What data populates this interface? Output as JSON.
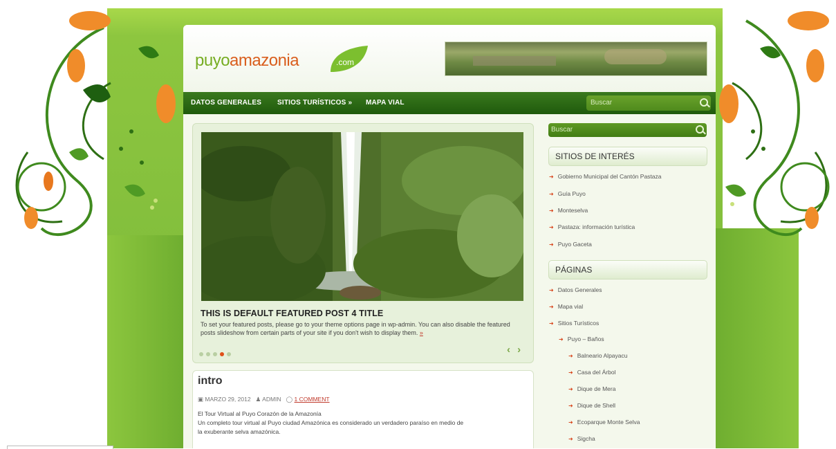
{
  "colors": {
    "green": "#8dc63f",
    "dark_green": "#2b6a14",
    "orange": "#e0501a"
  },
  "logo": {
    "part1": "puyo",
    "part2": "amazonia",
    "tld": ".com"
  },
  "nav": {
    "items": [
      {
        "label": "DATOS GENERALES"
      },
      {
        "label": "SITIOS TURÍSTICOS »"
      },
      {
        "label": "MAPA VIAL"
      }
    ],
    "search_placeholder": "Buscar"
  },
  "featured": {
    "title": "THIS IS DEFAULT FEATURED POST 4 TITLE",
    "text": "To set your featured posts, please go to your theme options page in wp-admin. You can also disable the featured posts slideshow from certain parts of your site if you don't wish to display them.",
    "more": "»",
    "active_slide": 4,
    "slide_count": 5,
    "prev_icon": "‹",
    "next_icon": "›"
  },
  "post": {
    "title": "intro",
    "date": "MARZO 29, 2012",
    "author": "ADMIN",
    "comments": "1 COMMENT",
    "line1": "El Tour Virtual al Puyo Corazón de la Amazonía",
    "line2": "Un completo tour virtual al Puyo ciudad Amazónica es considerado un verdadero paraíso en medio   de",
    "line3": "la   exuberante   selva amazónica."
  },
  "sidebar": {
    "search_placeholder": "Buscar",
    "w1_title": "SITIOS DE INTERÉS",
    "w1_links": [
      "Gobierno Municipal del Cantón Pastaza",
      "Guía Puyo",
      "Monteselva",
      "Pastaza: información turística",
      "Puyo Gaceta"
    ],
    "w2_title": "PÁGINAS",
    "w2_links": [
      "Datos Generales",
      "Mapa vial",
      "Sitios Turísticos",
      "Puyo – Baños",
      "Balneario Alpayacu",
      "Casa del Árbol",
      "Dique de Mera",
      "Dique de Shell",
      "Ecoparque Monte Selva",
      "Sigcha"
    ]
  }
}
